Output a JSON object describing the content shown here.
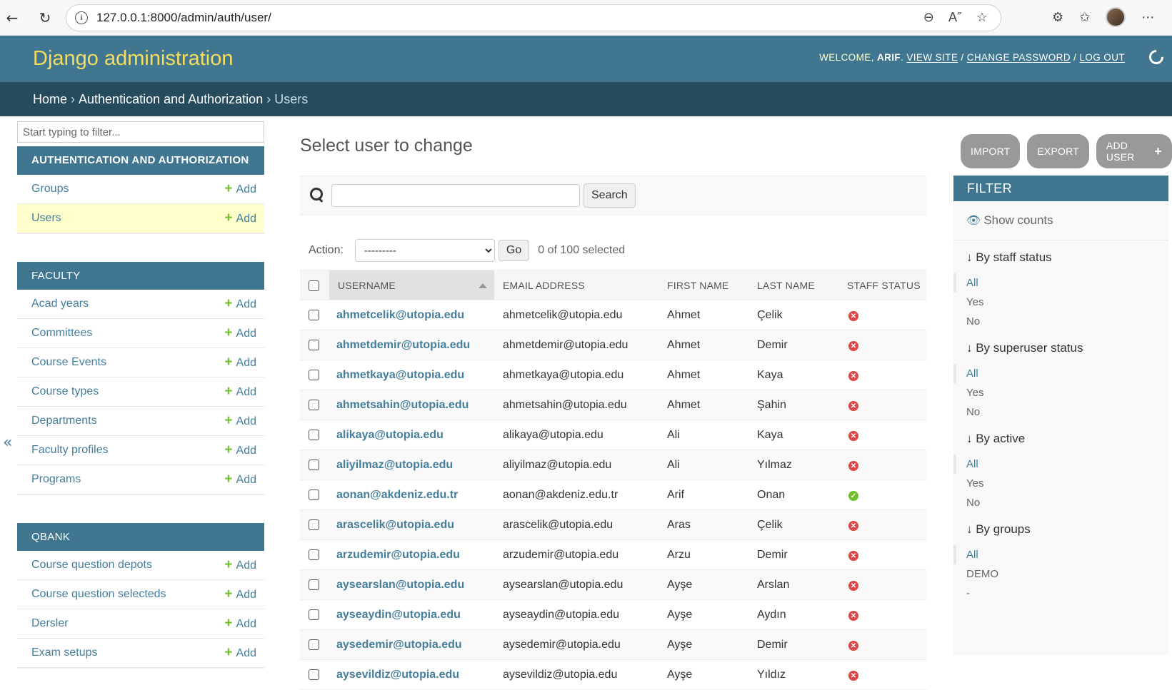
{
  "browser": {
    "url": "127.0.0.1:8000/admin/auth/user/"
  },
  "header": {
    "brand": "Django administration",
    "welcome": "WELCOME,",
    "username": "ARIF",
    "view_site": "VIEW SITE",
    "change_password": "CHANGE PASSWORD",
    "log_out": "LOG OUT"
  },
  "breadcrumbs": {
    "home": "Home",
    "app": "Authentication and Authorization",
    "current": "Users"
  },
  "sidebar": {
    "filter_placeholder": "Start typing to filter...",
    "add_label": "Add",
    "modules": [
      {
        "caption": "AUTHENTICATION AND AUTHORIZATION",
        "models": [
          {
            "name": "Groups",
            "current": false
          },
          {
            "name": "Users",
            "current": true
          }
        ]
      },
      {
        "caption": "FACULTY",
        "models": [
          {
            "name": "Acad years",
            "current": false
          },
          {
            "name": "Committees",
            "current": false
          },
          {
            "name": "Course Events",
            "current": false
          },
          {
            "name": "Course types",
            "current": false
          },
          {
            "name": "Departments",
            "current": false
          },
          {
            "name": "Faculty profiles",
            "current": false
          },
          {
            "name": "Programs",
            "current": false
          }
        ]
      },
      {
        "caption": "QBANK",
        "models": [
          {
            "name": "Course question depots",
            "current": false
          },
          {
            "name": "Course question selecteds",
            "current": false
          },
          {
            "name": "Dersler",
            "current": false
          },
          {
            "name": "Exam setups",
            "current": false
          }
        ]
      }
    ]
  },
  "main": {
    "title": "Select user to change",
    "object_tools": {
      "import": "IMPORT",
      "export": "EXPORT",
      "add_user": "ADD USER"
    },
    "search_button": "Search",
    "search_value": "",
    "action_label": "Action:",
    "action_selected": "---------",
    "go_button": "Go",
    "counter": "0 of 100 selected",
    "columns": [
      "USERNAME",
      "EMAIL ADDRESS",
      "FIRST NAME",
      "LAST NAME",
      "STAFF STATUS"
    ],
    "rows": [
      {
        "username": "ahmetcelik@utopia.edu",
        "email": "ahmetcelik@utopia.edu",
        "first": "Ahmet",
        "last": "Çelik",
        "staff": false
      },
      {
        "username": "ahmetdemir@utopia.edu",
        "email": "ahmetdemir@utopia.edu",
        "first": "Ahmet",
        "last": "Demir",
        "staff": false
      },
      {
        "username": "ahmetkaya@utopia.edu",
        "email": "ahmetkaya@utopia.edu",
        "first": "Ahmet",
        "last": "Kaya",
        "staff": false
      },
      {
        "username": "ahmetsahin@utopia.edu",
        "email": "ahmetsahin@utopia.edu",
        "first": "Ahmet",
        "last": "Şahin",
        "staff": false
      },
      {
        "username": "alikaya@utopia.edu",
        "email": "alikaya@utopia.edu",
        "first": "Ali",
        "last": "Kaya",
        "staff": false
      },
      {
        "username": "aliyilmaz@utopia.edu",
        "email": "aliyilmaz@utopia.edu",
        "first": "Ali",
        "last": "Yılmaz",
        "staff": false
      },
      {
        "username": "aonan@akdeniz.edu.tr",
        "email": "aonan@akdeniz.edu.tr",
        "first": "Arif",
        "last": "Onan",
        "staff": true
      },
      {
        "username": "arascelik@utopia.edu",
        "email": "arascelik@utopia.edu",
        "first": "Aras",
        "last": "Çelik",
        "staff": false
      },
      {
        "username": "arzudemir@utopia.edu",
        "email": "arzudemir@utopia.edu",
        "first": "Arzu",
        "last": "Demir",
        "staff": false
      },
      {
        "username": "aysearslan@utopia.edu",
        "email": "aysearslan@utopia.edu",
        "first": "Ayşe",
        "last": "Arslan",
        "staff": false
      },
      {
        "username": "ayseaydin@utopia.edu",
        "email": "ayseaydin@utopia.edu",
        "first": "Ayşe",
        "last": "Aydın",
        "staff": false
      },
      {
        "username": "aysedemir@utopia.edu",
        "email": "aysedemir@utopia.edu",
        "first": "Ayşe",
        "last": "Demir",
        "staff": false
      },
      {
        "username": "aysevildiz@utopia.edu",
        "email": "aysevildiz@utopia.edu",
        "first": "Ayşe",
        "last": "Yıldız",
        "staff": false
      }
    ]
  },
  "filter": {
    "title": "FILTER",
    "show_counts": "Show counts",
    "groups": [
      {
        "title": "↓ By staff status",
        "options": [
          "All",
          "Yes",
          "No"
        ],
        "selected": 0
      },
      {
        "title": "↓ By superuser status",
        "options": [
          "All",
          "Yes",
          "No"
        ],
        "selected": 0
      },
      {
        "title": "↓ By active",
        "options": [
          "All",
          "Yes",
          "No"
        ],
        "selected": 0
      },
      {
        "title": "↓ By groups",
        "options": [
          "All",
          "DEMO",
          "-"
        ],
        "selected": 0
      }
    ]
  },
  "colors": {
    "header_bg": "#417690",
    "breadcrumb_bg": "#264b5d",
    "brand": "#f5dd5d",
    "link": "#447e9b",
    "current_row": "#ffffcc",
    "add_plus": "#70bf2b",
    "status_no": "#dd4646",
    "status_yes": "#70bf2b"
  }
}
